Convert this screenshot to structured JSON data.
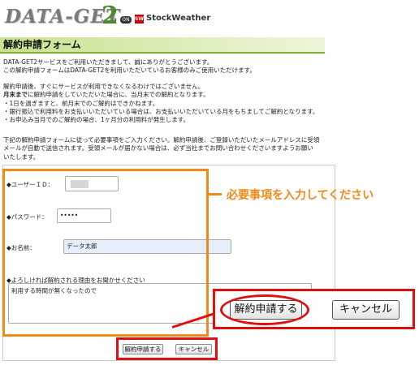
{
  "header": {
    "logo_text": "DATA-GET",
    "logo_num": "2",
    "on_badge": "ON",
    "partner_icon": "SW",
    "partner": "StockWeather"
  },
  "page_title": "解約申請フォーム",
  "intro": {
    "line1": "DATA-GET2サービスをご利用いただきまして、誠にありがとうございます。",
    "line2": "この解約申請フォームはDATA-GET2を利用いただいているお客様のみご使用いただけます。"
  },
  "notes": {
    "line1": "解約申請後、すぐにサービスが利用できなくなるわけではございません。",
    "line2_bold": "月末まで",
    "line2_rest": "に解約申請をしていただいた場合に、当月末での解約となります。",
    "line3": "・1日を過ぎますと、前月末でのご解約はできかねます。",
    "line4": "・銀行振込で利用料をお支払いいただいている場合は、お支払いいただいている月をもちましてご解約となります。",
    "line5": "・お申込み当月でのご解約の場合、1ヶ月分の利用料が発生します。"
  },
  "instructions": {
    "line1": "下記の解約申請フォームに従って必要事項をご入力ください。解約申請後、ご登録いただいたメールアドレスに受領",
    "line2": "メールが自動で送信されます。受領メールが届かない場合は、必ず当社までお問い合わせくださいますようお願い",
    "line3": "いたします。"
  },
  "form": {
    "user_id_label": "◆ユーザーＩＤ：",
    "password_label": "◆パスワード：",
    "password_value": "•••••",
    "name_label": "◆お名前：",
    "name_value": "データ太郎",
    "reason_label": "◆よろしければ解約される理由をお聞かせください",
    "reason_value": "利用する時間が無くなったので",
    "submit_label": "解約申請する",
    "cancel_label": "キャンセル"
  },
  "annotation": {
    "required_note": "必要事項を入力してください",
    "zoom_submit": "解約申請する",
    "zoom_cancel": "キャンセル"
  },
  "colors": {
    "accent_green": "#7fb034",
    "annotation_orange": "#f08a19",
    "annotation_red": "#e01010"
  }
}
